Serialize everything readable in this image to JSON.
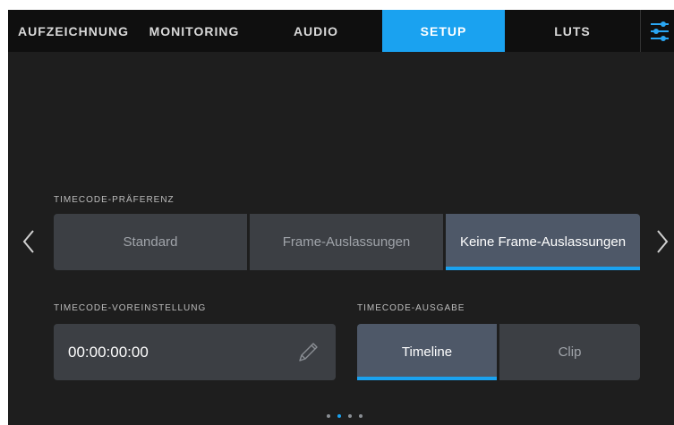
{
  "tabs": [
    {
      "label": "AUFZEICHNUNG",
      "active": false
    },
    {
      "label": "MONITORING",
      "active": false
    },
    {
      "label": "AUDIO",
      "active": false
    },
    {
      "label": "SETUP",
      "active": true
    },
    {
      "label": "LUTS",
      "active": false
    }
  ],
  "timecode_praeferenz": {
    "label": "TIMECODE-PRÄFERENZ",
    "options": [
      "Standard",
      "Frame-Auslassungen",
      "Keine Frame-Auslassungen"
    ],
    "selected": "Keine Frame-Auslassungen"
  },
  "timecode_voreinstellung": {
    "label": "TIMECODE-VOREINSTELLUNG",
    "value": "00:00:00:00"
  },
  "timecode_ausgabe": {
    "label": "TIMECODE-AUSGABE",
    "options": [
      "Timeline",
      "Clip"
    ],
    "selected": "Timeline"
  },
  "pagination": {
    "total": 4,
    "current": 2
  },
  "colors": {
    "accent": "#1aa2f0",
    "background": "#1e1e1e",
    "tabbar": "#0f0f0f",
    "button": "#3c3f44",
    "button_active": "#4e5868"
  },
  "icons": [
    "menu-settings-icon",
    "chevron-left-icon",
    "chevron-right-icon",
    "pencil-icon"
  ]
}
